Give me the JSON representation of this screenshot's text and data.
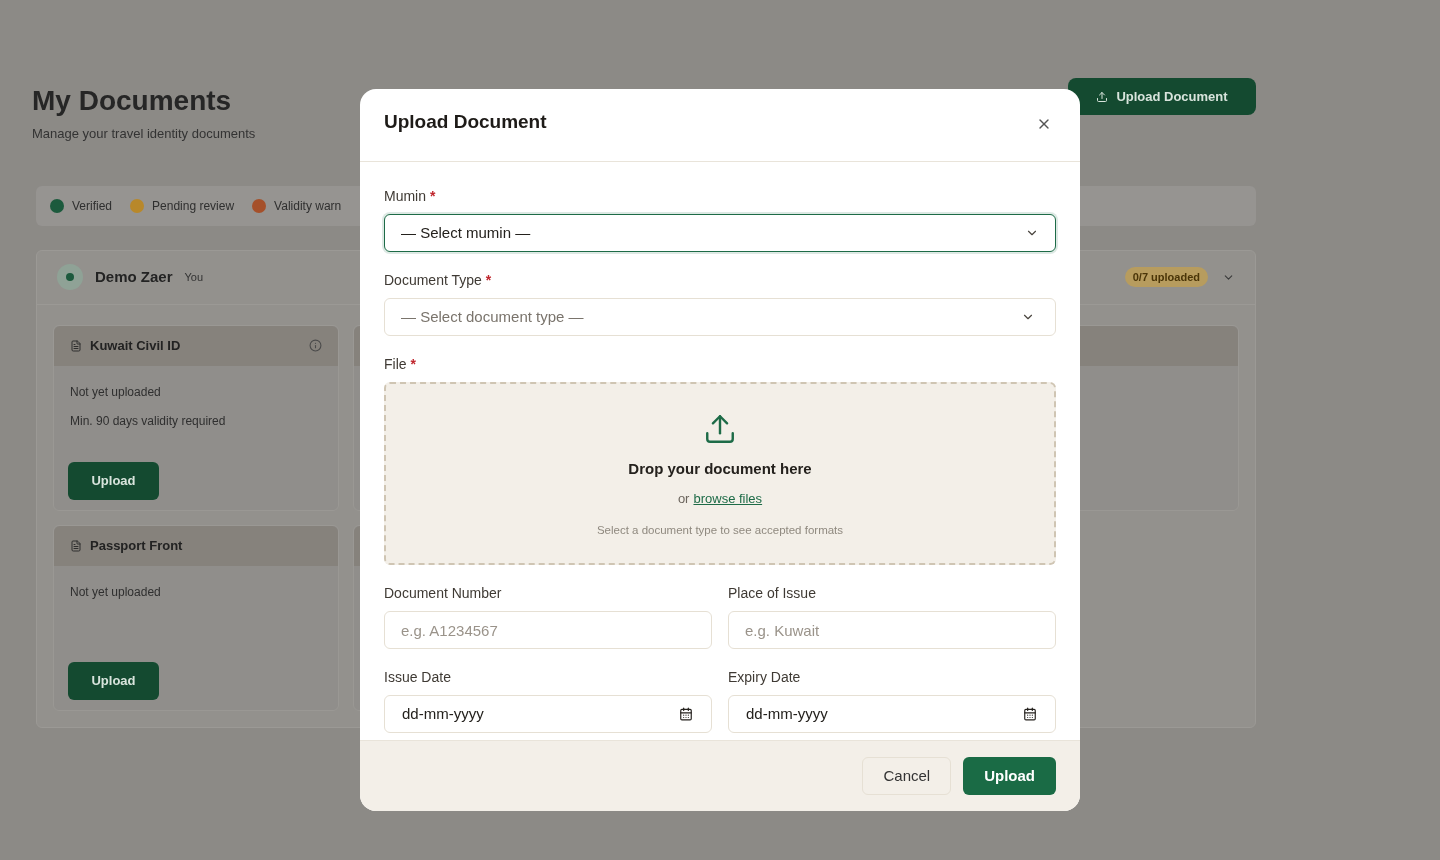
{
  "page": {
    "title": "My Documents",
    "subtitle": "Manage your travel identity documents",
    "action_button": "Upload Document"
  },
  "legend": [
    {
      "label": "Verified",
      "color": "#1c5a3d"
    },
    {
      "label": "Pending review",
      "color": "#b8882a"
    },
    {
      "label": "Validity warn",
      "color": "#a5502a"
    }
  ],
  "member": {
    "name": "Demo Zaer",
    "tag": "You",
    "badge": "0/7 uploaded"
  },
  "documents": [
    {
      "title": "Kuwait Civil ID",
      "status": "Not yet uploaded",
      "note": "Min. 90 days validity required",
      "button": "Upload"
    },
    {
      "title": "Passport Front",
      "status": "Not yet uploaded",
      "button": "Upload"
    }
  ],
  "dialog": {
    "title": "Upload Document",
    "fields": [
      {
        "kind": "select",
        "label": "Mumin",
        "marker": "*",
        "value": "— Select mumin —",
        "focused": true
      },
      {
        "kind": "select",
        "label": "Document Type",
        "marker": "*",
        "placeholder": "— Select document type —",
        "focused": false
      },
      {
        "kind": "dropzone",
        "label": "File",
        "marker": "*",
        "title": "Drop your document here",
        "prefix": "or",
        "link": "browse files",
        "hint": "Select a document type to see accepted formats"
      },
      {
        "kind": "text",
        "label": "Document Number",
        "placeholder": "e.g. A1234567"
      },
      {
        "kind": "text",
        "label": "Place of Issue",
        "placeholder": "e.g. Kuwait"
      },
      {
        "kind": "date",
        "label": "Issue Date",
        "value": "dd-mm-yyyy"
      },
      {
        "kind": "date",
        "label": "Expiry Date",
        "value": "dd-mm-yyyy"
      }
    ],
    "buttons": [
      {
        "kind": "secondary",
        "label": "Cancel"
      },
      {
        "kind": "primary",
        "label": "Upload"
      }
    ]
  }
}
